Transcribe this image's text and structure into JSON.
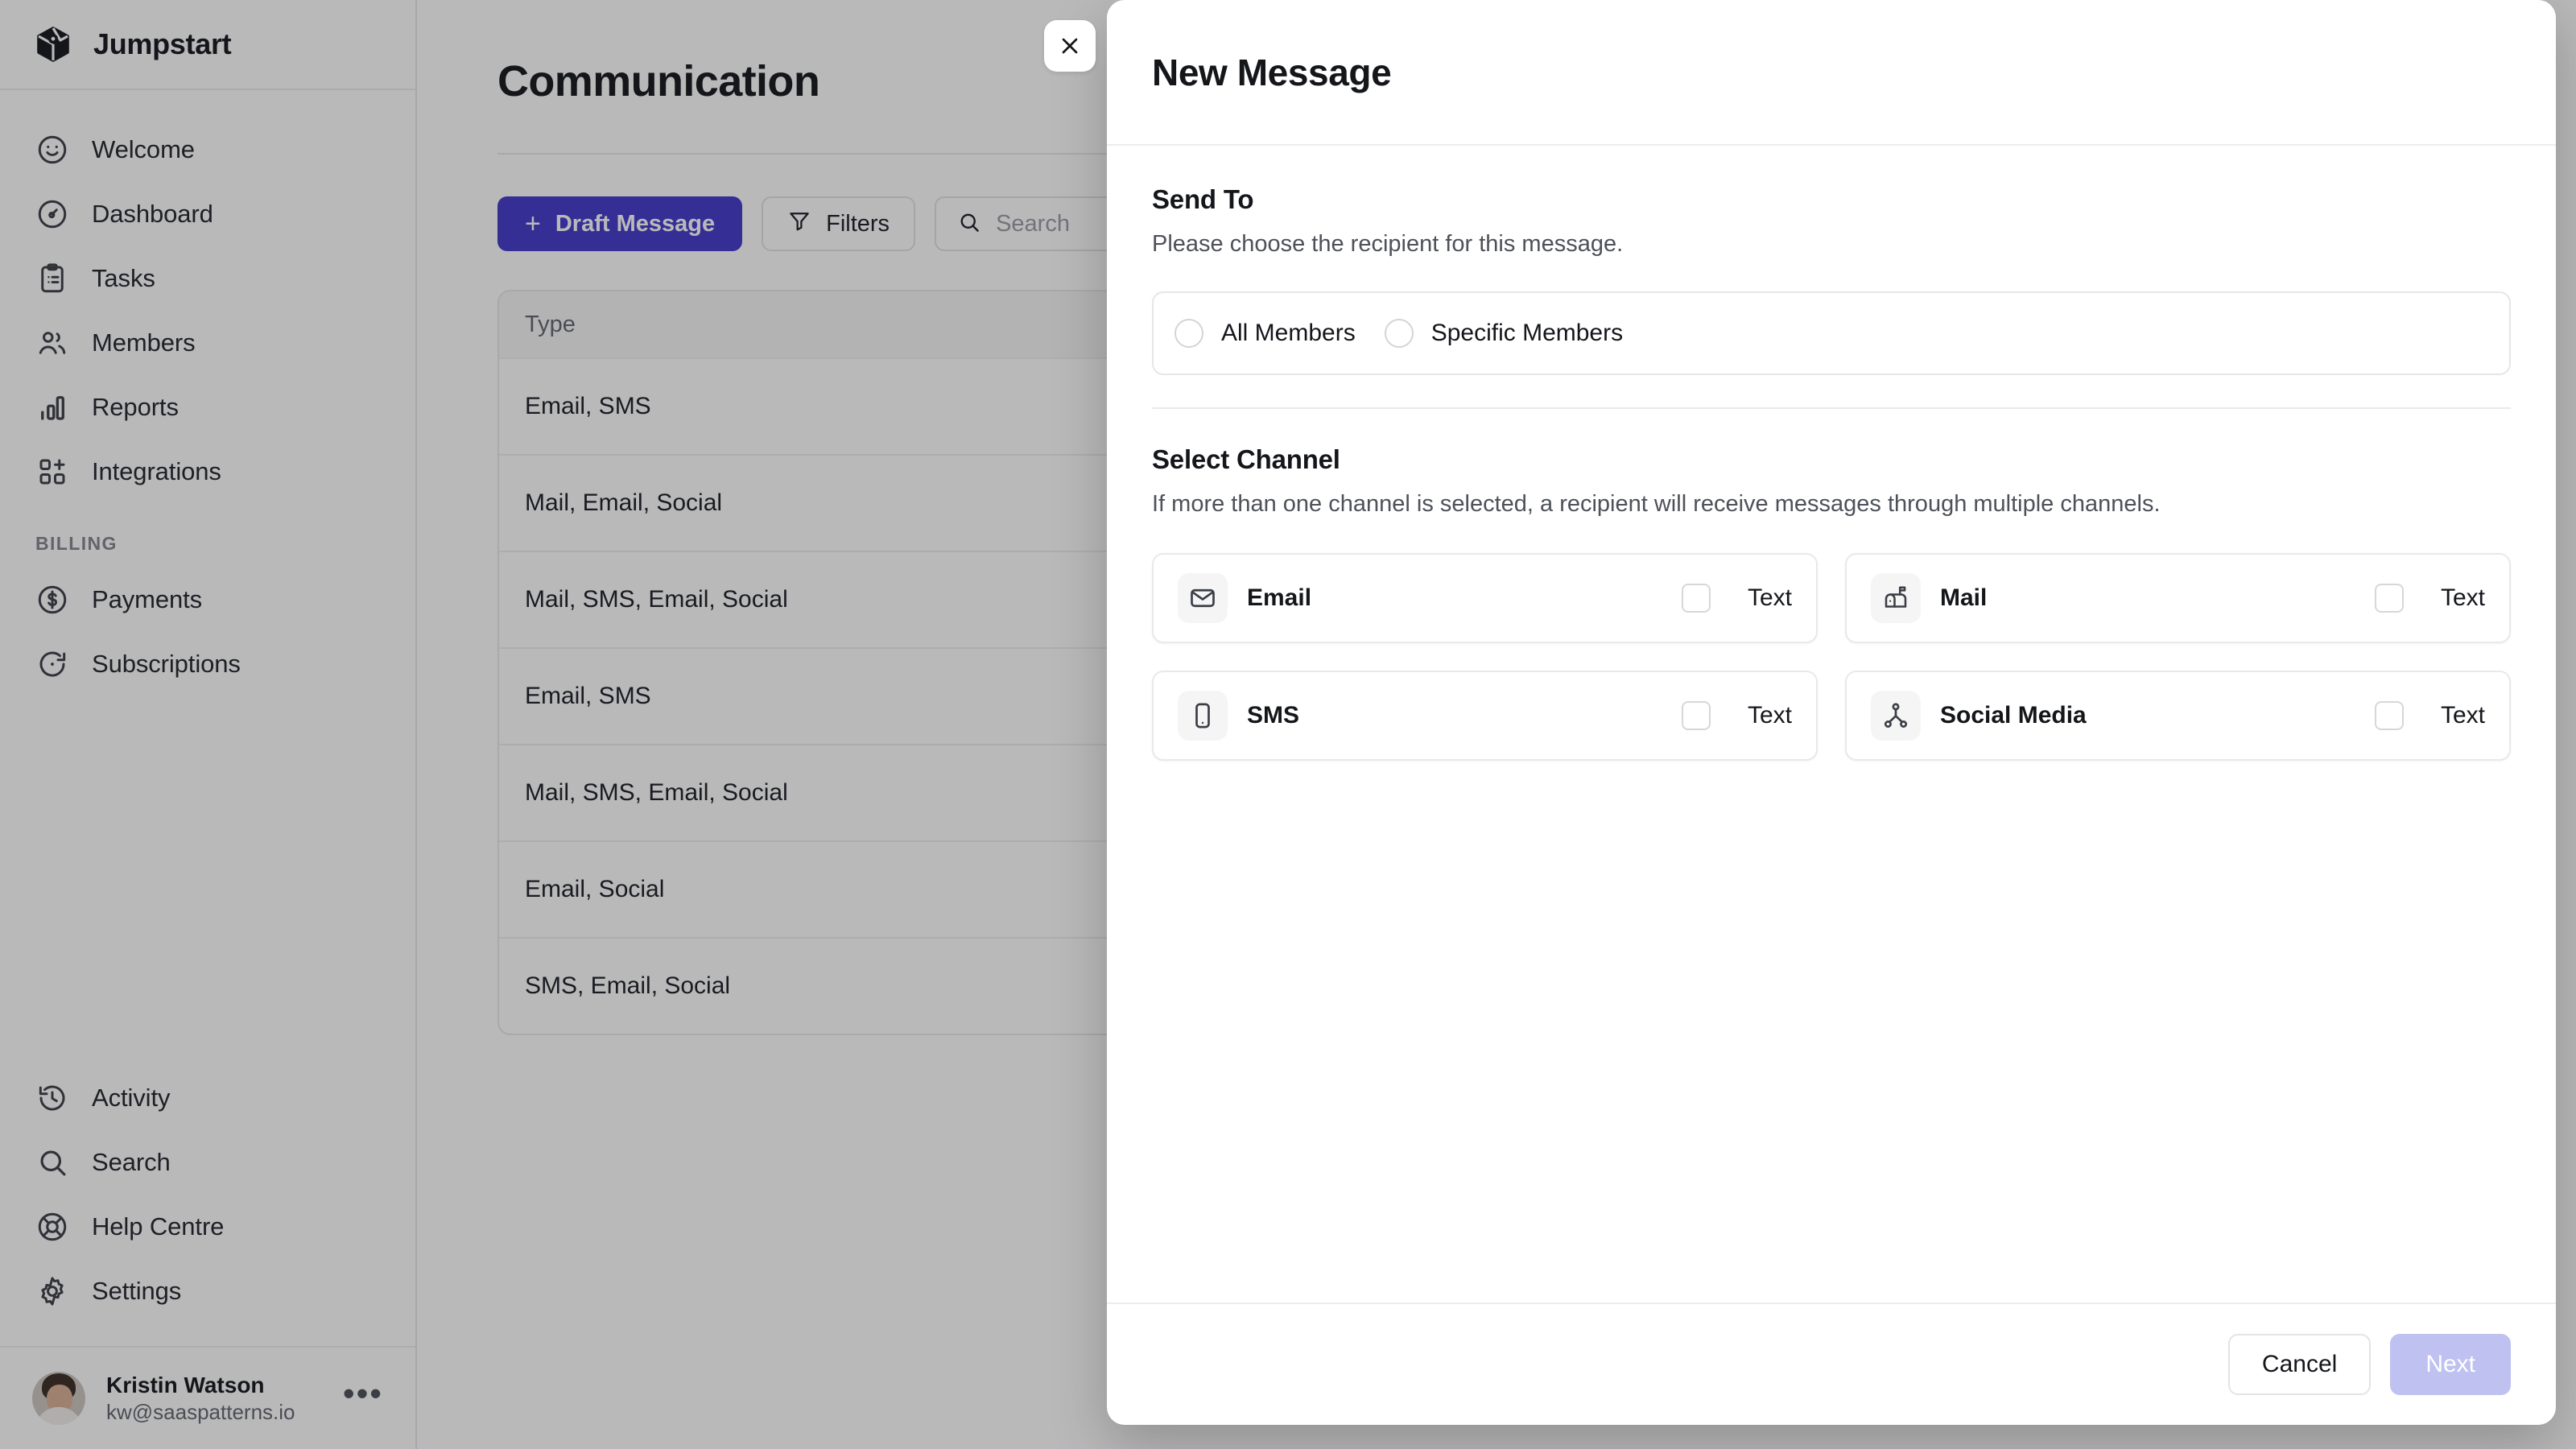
{
  "sidebar": {
    "brand": {
      "name": "Jumpstart",
      "logo_icon": "cube-icon"
    },
    "items": [
      {
        "label": "Welcome",
        "icon": "smiley-icon"
      },
      {
        "label": "Dashboard",
        "icon": "gauge-icon"
      },
      {
        "label": "Tasks",
        "icon": "clipboard-icon"
      },
      {
        "label": "Members",
        "icon": "users-icon"
      },
      {
        "label": "Reports",
        "icon": "bar-chart-icon"
      },
      {
        "label": "Integrations",
        "icon": "grid-plus-icon"
      }
    ],
    "section_title": "BILLING",
    "billing_items": [
      {
        "label": "Payments",
        "icon": "dollar-circle-icon"
      },
      {
        "label": "Subscriptions",
        "icon": "refresh-icon"
      }
    ],
    "bottom_items": [
      {
        "label": "Activity",
        "icon": "history-icon"
      },
      {
        "label": "Search",
        "icon": "search-icon"
      },
      {
        "label": "Help Centre",
        "icon": "lifebuoy-icon"
      },
      {
        "label": "Settings",
        "icon": "gear-icon"
      }
    ],
    "profile": {
      "name": "Kristin Watson",
      "email": "kw@saaspatterns.io",
      "more_glyph": "•••"
    }
  },
  "main": {
    "page_title": "Communication",
    "toolbar": {
      "draft_label": "Draft Message",
      "draft_plus": "+",
      "filters_label": "Filters",
      "filters_icon": "funnel-icon",
      "search_icon": "search-icon",
      "search_placeholder": "Search",
      "search_value": ""
    },
    "table": {
      "columns": [
        "Type"
      ],
      "rows": [
        [
          "Email, SMS"
        ],
        [
          "Mail, Email, Social"
        ],
        [
          "Mail, SMS, Email, Social"
        ],
        [
          "Email, SMS"
        ],
        [
          "Mail, SMS, Email, Social"
        ],
        [
          "Email, Social"
        ],
        [
          "SMS, Email, Social"
        ]
      ]
    }
  },
  "modal": {
    "title": "New Message",
    "close_icon": "close-icon",
    "send_to": {
      "heading": "Send To",
      "description": "Please choose the recipient for this message.",
      "options": [
        {
          "label": "All Members",
          "selected": false
        },
        {
          "label": "Specific Members",
          "selected": false
        }
      ]
    },
    "select_channel": {
      "heading": "Select Channel",
      "description": "If more than one channel is selected, a recipient will receive messages through multiple channels.",
      "channels": [
        {
          "name": "Email",
          "icon": "envelope-icon",
          "checkbox_label": "Text",
          "checked": false
        },
        {
          "name": "Mail",
          "icon": "mailbox-icon",
          "checkbox_label": "Text",
          "checked": false
        },
        {
          "name": "SMS",
          "icon": "smartphone-icon",
          "checkbox_label": "Text",
          "checked": false
        },
        {
          "name": "Social Media",
          "icon": "share-network-icon",
          "checkbox_label": "Text",
          "checked": false
        }
      ]
    },
    "footer": {
      "cancel_label": "Cancel",
      "next_label": "Next",
      "next_disabled": true
    }
  },
  "colors": {
    "accent": "#4338CA",
    "accent_disabled": "#BFC1F0",
    "overlay": "rgba(22,24,28,0.30)",
    "text_primary": "#14161A",
    "text_muted": "#62656C"
  }
}
